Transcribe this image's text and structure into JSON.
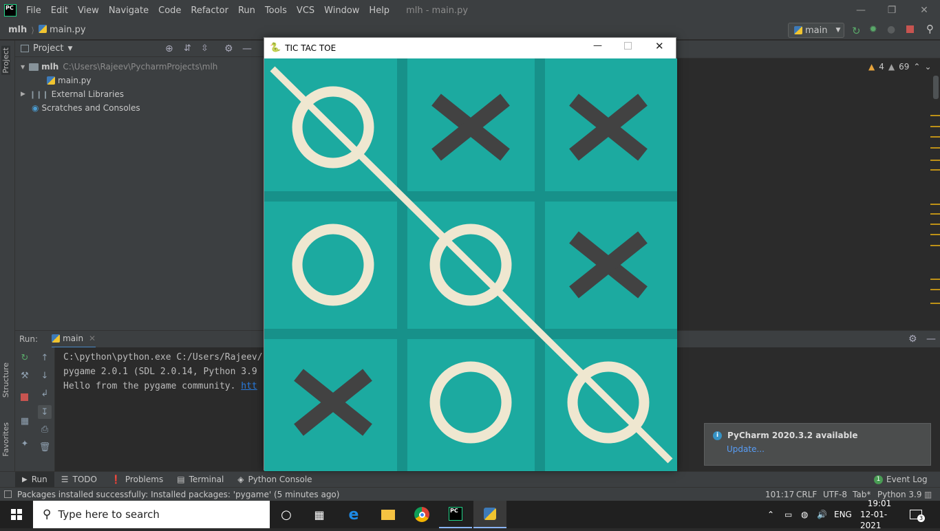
{
  "titlebar": {
    "logo": "PC",
    "menu": [
      "File",
      "Edit",
      "View",
      "Navigate",
      "Code",
      "Refactor",
      "Run",
      "Tools",
      "VCS",
      "Window",
      "Help"
    ],
    "title": "mlh - main.py"
  },
  "navbar": {
    "project": "mlh",
    "file": "main.py",
    "run_config": "main"
  },
  "project_panel": {
    "title": "Project",
    "root_name": "mlh",
    "root_path": "C:\\Users\\Rajeev\\PycharmProjects\\mlh",
    "file": "main.py",
    "external": "External Libraries",
    "scratches": "Scratches and Consoles"
  },
  "side_tabs": {
    "project": "Project",
    "structure": "Structure",
    "favorites": "Favorites"
  },
  "inspections": {
    "errors": "4",
    "warnings": "69"
  },
  "run_panel": {
    "label": "Run:",
    "tab": "main",
    "lines": [
      "C:\\python\\python.exe C:/Users/Rajeev/",
      "pygame 2.0.1 (SDL 2.0.14, Python 3.9",
      "Hello from the pygame community. "
    ],
    "link_text": "htt"
  },
  "tool_tabs": [
    "Run",
    "TODO",
    "Problems",
    "Terminal",
    "Python Console"
  ],
  "event_log": {
    "count": "1",
    "label": "Event Log"
  },
  "statusbar": {
    "message": "Packages installed successfully: Installed packages: 'pygame' (5 minutes ago)",
    "position": "101:17",
    "line_sep": "CRLF",
    "encoding": "UTF-8",
    "indent": "Tab*",
    "interpreter": "Python 3.9"
  },
  "notification": {
    "title": "PyCharm 2020.3.2 available",
    "link": "Update..."
  },
  "game": {
    "title": "TIC TAC TOE",
    "board": [
      [
        "O",
        "X",
        "X"
      ],
      [
        "O",
        "O",
        "X"
      ],
      [
        "X",
        "O",
        "O"
      ]
    ],
    "colors": {
      "bg": "#1caaa0",
      "grid": "#17918a",
      "x": "#424242",
      "o": "#efe7d0"
    }
  },
  "taskbar": {
    "search": "Type here to search",
    "lang": "ENG",
    "time": "19:01",
    "date": "12-01-2021",
    "notifications": "3"
  }
}
